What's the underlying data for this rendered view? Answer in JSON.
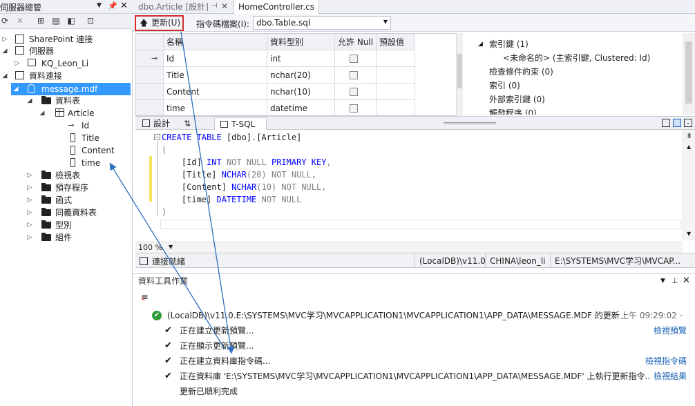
{
  "server_explorer": {
    "title": "伺服器總管",
    "pin_icon": "pin-icon",
    "tree": {
      "sharepoint": "SharePoint 連接",
      "servers": "伺服器",
      "server_node": "KQ_Leon_Li",
      "data_connections": "資料連接",
      "database": "message.mdf",
      "tables": "資料表",
      "table": "Article",
      "columns": [
        "Id",
        "Title",
        "Content",
        "time"
      ],
      "folders": [
        "檢視表",
        "預存程序",
        "函式",
        "同義資料表",
        "型別",
        "組件"
      ]
    }
  },
  "tabs": [
    {
      "label": "dbo.Article [設計]"
    },
    {
      "label": "HomeController.cs"
    }
  ],
  "toolbar": {
    "update_label": "更新(U)",
    "script_label": "指令碼檔案(I):",
    "script_value": "dbo.Table.sql"
  },
  "grid": {
    "headers": [
      "名稱",
      "資料型別",
      "允許 Null",
      "預設值"
    ],
    "rows": [
      {
        "name": "Id",
        "type": "int"
      },
      {
        "name": "Title",
        "type": "nchar(20)"
      },
      {
        "name": "Content",
        "type": "nchar(10)"
      },
      {
        "name": "time",
        "type": "datetime"
      }
    ]
  },
  "properties": {
    "keys": "索引鍵 (1)",
    "key_item": "<未命名的> (主索引鍵, Clustered: Id)",
    "check_constraints": "檢查條件約束 (0)",
    "indexes": "索引 (0)",
    "foreign_keys": "外部索引鍵 (0)",
    "triggers": "觸發程序 (0)"
  },
  "split_tabs": {
    "design": "設計",
    "swap": "⇅",
    "tsql": "T-SQL"
  },
  "code": {
    "l1a": "CREATE TABLE",
    "l1b": " [dbo].[Article]",
    "l2": "(",
    "l3a": "    [Id] ",
    "l3b": "INT",
    "l3c": " NOT NULL ",
    "l3d": "PRIMARY KEY",
    "l3e": ",",
    "l4a": "    [Title] ",
    "l4b": "NCHAR",
    "l4c": "(20)",
    "l4d": " NOT NULL,",
    "l5a": "    [Content] ",
    "l5b": "NCHAR",
    "l5c": "(10)",
    "l5d": " NOT NULL,",
    "l6a": "    [time] ",
    "l6b": "DATETIME",
    "l6c": " NOT NULL",
    "l7": ")"
  },
  "zoom": "100 %",
  "status": {
    "connection": "連接就緒",
    "server": "(LocalDB)\\v11.0",
    "user": "CHINA\\leon_li",
    "path": "E:\\SYSTEMS\\MVC学习\\MVCAP..."
  },
  "data_tools": {
    "title": "資料工具作業",
    "summary": "(LocalDB)\\v11.0.E:\\SYSTEMS\\MVC学习\\MVCAPPLICATION1\\MVCAPPLICATION1\\APP_DATA\\MESSAGE.MDF 的更新",
    "summary_time": "上午 09:29:02 -",
    "steps": [
      {
        "text": "正在建立更新預覽...",
        "link": "檢視預覽"
      },
      {
        "text": "正在顯示更新預覽...",
        "link": ""
      },
      {
        "text": "正在建立資料庫指令碼...",
        "link": "檢視指令碼"
      },
      {
        "text": "正在資料庫 'E:\\SYSTEMS\\MVC学习\\MVCAPPLICATION1\\MVCAPPLICATION1\\APP_DATA\\MESSAGE.MDF' 上執行更新指令...",
        "link": "檢視結果"
      }
    ],
    "done": "更新已順利完成"
  }
}
